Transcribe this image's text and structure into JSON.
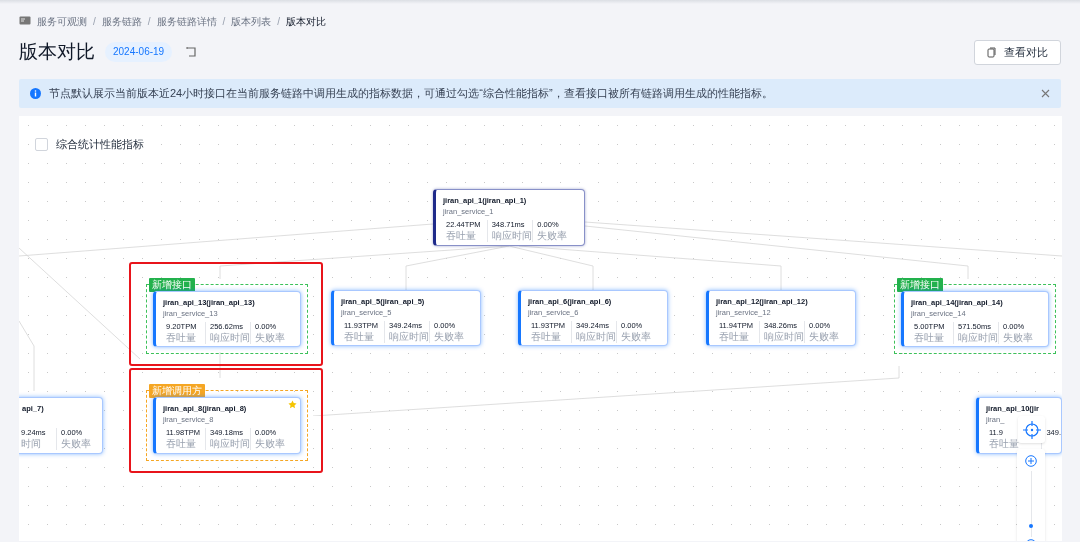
{
  "breadcrumb_separator": "/",
  "breadcrumb": [
    {
      "label": "服务可观测",
      "current": false
    },
    {
      "label": "服务链路",
      "current": false
    },
    {
      "label": "服务链路详情",
      "current": false
    },
    {
      "label": "版本列表",
      "current": false
    },
    {
      "label": "版本对比",
      "current": true
    }
  ],
  "title": "版本对比",
  "date_tag": "2024-06-19",
  "compare_button": "查看对比",
  "notice": {
    "text": "节点默认展示当前版本近24小时接口在当前服务链路中调用生成的指标数据，可通过勾选“综合性能指标”，查看接口被所有链路调用生成的性能指标。"
  },
  "canvas": {
    "combined_metrics": {
      "label": "综合统计性能指标",
      "checked": false
    },
    "nodes": [
      {
        "title": "jiran_api_1(jiran_api_1)",
        "service": "jiran_service_1",
        "root": true,
        "starred": false,
        "metrics": [
          {
            "value": "22.44TPM",
            "label": "吞吐量"
          },
          {
            "value": "348.71ms",
            "label": "响应时间"
          },
          {
            "value": "0.00%",
            "label": "失败率"
          }
        ]
      },
      {
        "title": "jiran_api_13(jiran_api_13)",
        "service": "jiran_service_13",
        "root": false,
        "highlighted": true,
        "starred": false,
        "tag": {
          "kind": "new_interface",
          "label": "新增接口"
        },
        "metrics": [
          {
            "value": "9.20TPM",
            "label": "吞吐量"
          },
          {
            "value": "256.62ms",
            "label": "响应时间"
          },
          {
            "value": "0.00%",
            "label": "失败率"
          }
        ]
      },
      {
        "title": "jiran_api_5(jiran_api_5)",
        "service": "jiran_service_5",
        "root": false,
        "starred": false,
        "metrics": [
          {
            "value": "11.93TPM",
            "label": "吞吐量"
          },
          {
            "value": "349.24ms",
            "label": "响应时间"
          },
          {
            "value": "0.00%",
            "label": "失败率"
          }
        ]
      },
      {
        "title": "jiran_api_6(jiran_api_6)",
        "service": "jiran_service_6",
        "root": false,
        "starred": false,
        "metrics": [
          {
            "value": "11.93TPM",
            "label": "吞吐量"
          },
          {
            "value": "349.24ms",
            "label": "响应时间"
          },
          {
            "value": "0.00%",
            "label": "失败率"
          }
        ]
      },
      {
        "title": "jiran_api_12(jiran_api_12)",
        "service": "jiran_service_12",
        "root": false,
        "starred": false,
        "metrics": [
          {
            "value": "11.94TPM",
            "label": "吞吐量"
          },
          {
            "value": "348.26ms",
            "label": "响应时间"
          },
          {
            "value": "0.00%",
            "label": "失败率"
          }
        ]
      },
      {
        "title": "jiran_api_14(jiran_api_14)",
        "service": "jiran_service_14",
        "root": false,
        "starred": false,
        "tag": {
          "kind": "new_interface",
          "label": "新增接口"
        },
        "metrics": [
          {
            "value": "5.00TPM",
            "label": "吞吐量"
          },
          {
            "value": "571.50ms",
            "label": "响应时间"
          },
          {
            "value": "0.00%",
            "label": "失败率"
          }
        ]
      },
      {
        "title": "api_7)",
        "root": false,
        "starred": false,
        "metrics": [
          {
            "value": "9.24ms",
            "label": "时间"
          },
          {
            "value": "0.00%",
            "label": "失败率"
          }
        ]
      },
      {
        "title": "jiran_api_8(jiran_api_8)",
        "service": "jiran_service_8",
        "root": false,
        "highlighted": true,
        "starred": true,
        "tag": {
          "kind": "new_caller",
          "label": "新增调用方"
        },
        "metrics": [
          {
            "value": "11.98TPM",
            "label": "吞吐量"
          },
          {
            "value": "349.18ms",
            "label": "响应时间"
          },
          {
            "value": "0.00%",
            "label": "失败率"
          }
        ]
      },
      {
        "title": "jiran_api_10(jir",
        "service": "jiran_",
        "root": false,
        "starred": false,
        "metrics": [
          {
            "value": "11.9",
            "label": "吞吐量"
          },
          {
            "value": "349."
          }
        ]
      }
    ],
    "zoom_slider": {
      "level": 0.15
    }
  }
}
